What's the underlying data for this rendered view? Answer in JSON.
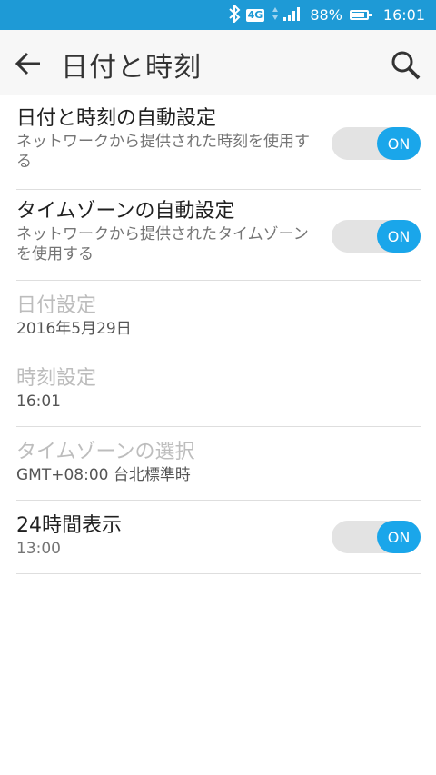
{
  "status_bar": {
    "network": "4G",
    "battery_percent": "88%",
    "battery_level": 0.88,
    "time": "16:01"
  },
  "app_bar": {
    "title": "日付と時刻"
  },
  "settings": {
    "auto_datetime": {
      "title": "日付と時刻の自動設定",
      "summary": "ネットワークから提供された時刻を使用する",
      "toggle": "ON"
    },
    "auto_timezone": {
      "title": "タイムゾーンの自動設定",
      "summary": "ネットワークから提供されたタイムゾーンを使用する",
      "toggle": "ON"
    },
    "set_date": {
      "title": "日付設定",
      "value": "2016年5月29日"
    },
    "set_time": {
      "title": "時刻設定",
      "value": "16:01"
    },
    "select_timezone": {
      "title": "タイムゾーンの選択",
      "value": "GMT+08:00 台北標準時"
    },
    "format_24h": {
      "title": "24時間表示",
      "value": "13:00",
      "toggle": "ON"
    }
  },
  "colors": {
    "status_bar": "#1e9ad6",
    "app_bar": "#f7f7f7",
    "toggle_on": "#1aa6ea",
    "toggle_track": "#e3e3e3",
    "divider": "#dedede"
  }
}
